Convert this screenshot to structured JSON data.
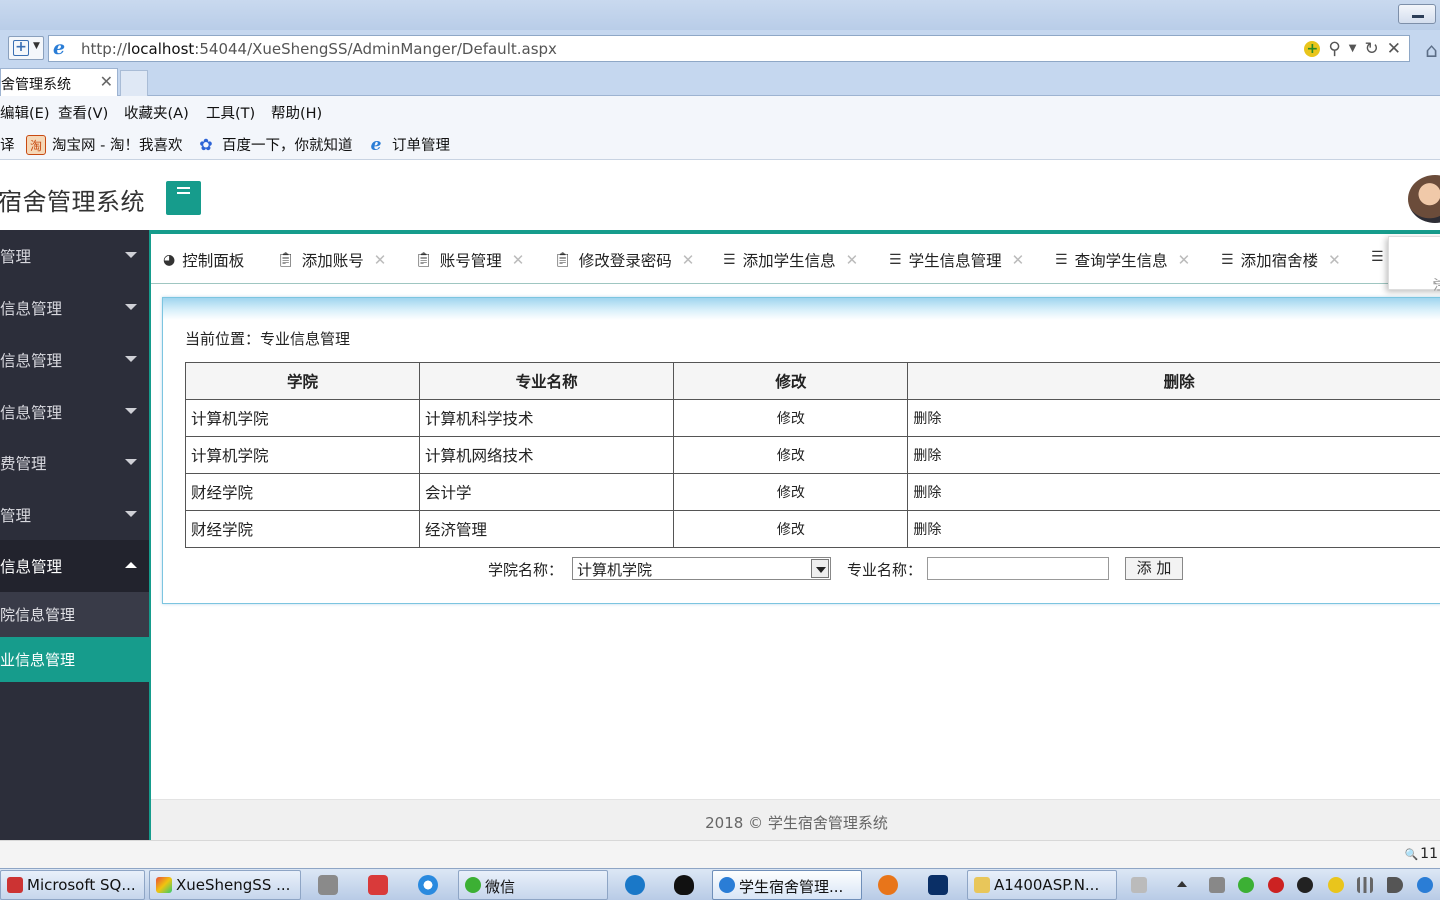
{
  "browser": {
    "url_prefix": "http://",
    "url_host": "localhost",
    "url_rest": ":54044/XueShengSS/AdminManger/Default.aspx",
    "tab_title": "舍管理系统",
    "menu": [
      "编辑(E)",
      "查看(V)",
      "收藏夹(A)",
      "工具(T)",
      "帮助(H)"
    ],
    "favorites": [
      "译",
      "淘宝网 - 淘！我喜欢",
      "百度一下，你就知道",
      "订单管理"
    ]
  },
  "app": {
    "title": "宿舍管理系统",
    "sidebar": {
      "items": [
        {
          "label": "管理",
          "open": false
        },
        {
          "label": "信息管理",
          "open": false
        },
        {
          "label": "信息管理",
          "open": false
        },
        {
          "label": "信息管理",
          "open": false
        },
        {
          "label": "费管理",
          "open": false
        },
        {
          "label": "管理",
          "open": false
        },
        {
          "label": "信息管理",
          "open": true
        }
      ],
      "subitems": [
        {
          "label": "院信息管理",
          "active": false
        },
        {
          "label": "业信息管理",
          "active": true
        }
      ]
    },
    "page_tabs": [
      {
        "icon": "dashboard-icon",
        "label": "控制面板",
        "closable": false
      },
      {
        "icon": "clipboard-icon",
        "label": "添加账号",
        "closable": true
      },
      {
        "icon": "clipboard-icon",
        "label": "账号管理",
        "closable": true
      },
      {
        "icon": "clipboard-icon",
        "label": "修改登录密码",
        "closable": true
      },
      {
        "icon": "list-icon",
        "label": "添加学生信息",
        "closable": true
      },
      {
        "icon": "list-icon",
        "label": "学生信息管理",
        "closable": true
      },
      {
        "icon": "list-icon",
        "label": "查询学生信息",
        "closable": true
      },
      {
        "icon": "list-icon",
        "label": "添加宿舍楼",
        "closable": true
      }
    ],
    "logout_label": "注",
    "breadcrumb": "当前位置：专业信息管理",
    "table": {
      "headers": [
        "学院",
        "专业名称",
        "修改",
        "删除"
      ],
      "rows": [
        {
          "college": "计算机学院",
          "major": "计算机科学技术",
          "edit": "修改",
          "delete": "删除"
        },
        {
          "college": "计算机学院",
          "major": "计算机网络技术",
          "edit": "修改",
          "delete": "删除"
        },
        {
          "college": "财经学院",
          "major": "会计学",
          "edit": "修改",
          "delete": "删除"
        },
        {
          "college": "财经学院",
          "major": "经济管理",
          "edit": "修改",
          "delete": "删除"
        }
      ]
    },
    "add_form": {
      "college_label": "学院名称：",
      "college_selected": "计算机学院",
      "major_label": "专业名称：",
      "major_value": "",
      "submit_label": "添 加"
    },
    "footer": "2018 © 学生宿舍管理系统"
  },
  "statusbar": {
    "zoom": "11"
  },
  "taskbar": {
    "buttons": [
      "Microsoft SQ...",
      "XueShengSS ...",
      "微信",
      "学生宿舍管理...",
      "A1400ASP.N..."
    ]
  },
  "colors": {
    "accent": "#169c8c",
    "sidebar": "#2c2e3a",
    "panel_border": "#7cc5e0"
  }
}
